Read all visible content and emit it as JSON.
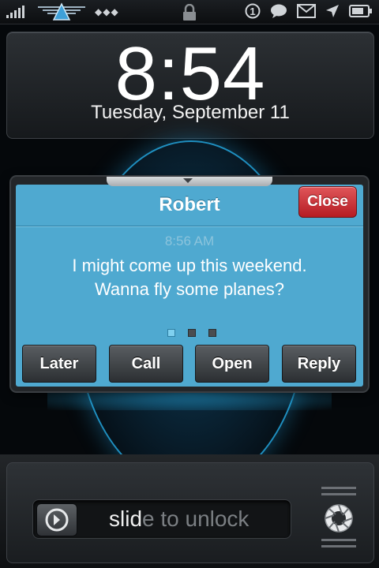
{
  "lockscreen": {
    "time": "8:54",
    "date": "Tuesday, September 11"
  },
  "notification": {
    "sender": "Robert",
    "close_label": "Close",
    "timestamp": "8:56 AM",
    "message_line1": "I might come up this weekend.",
    "message_line2": "Wanna fly some planes?",
    "page_count": 3,
    "current_page": 1,
    "actions": [
      {
        "label": "Later"
      },
      {
        "label": "Call"
      },
      {
        "label": "Open"
      },
      {
        "label": "Reply"
      }
    ]
  },
  "slider": {
    "text_highlight": "slid",
    "text_rest": "e to unlock"
  },
  "statusbar": {
    "badge_count": "1",
    "icons": [
      "signal-bars-icon",
      "app-logo-icon",
      "dots-icon",
      "lock-icon",
      "badge-icon",
      "chat-bubble-icon",
      "mail-icon",
      "location-arrow-icon",
      "battery-icon"
    ]
  },
  "colors": {
    "notification_bg": "#4fa9d0",
    "close_button": "#c9262d",
    "accent_glow": "#1f8fc0"
  }
}
